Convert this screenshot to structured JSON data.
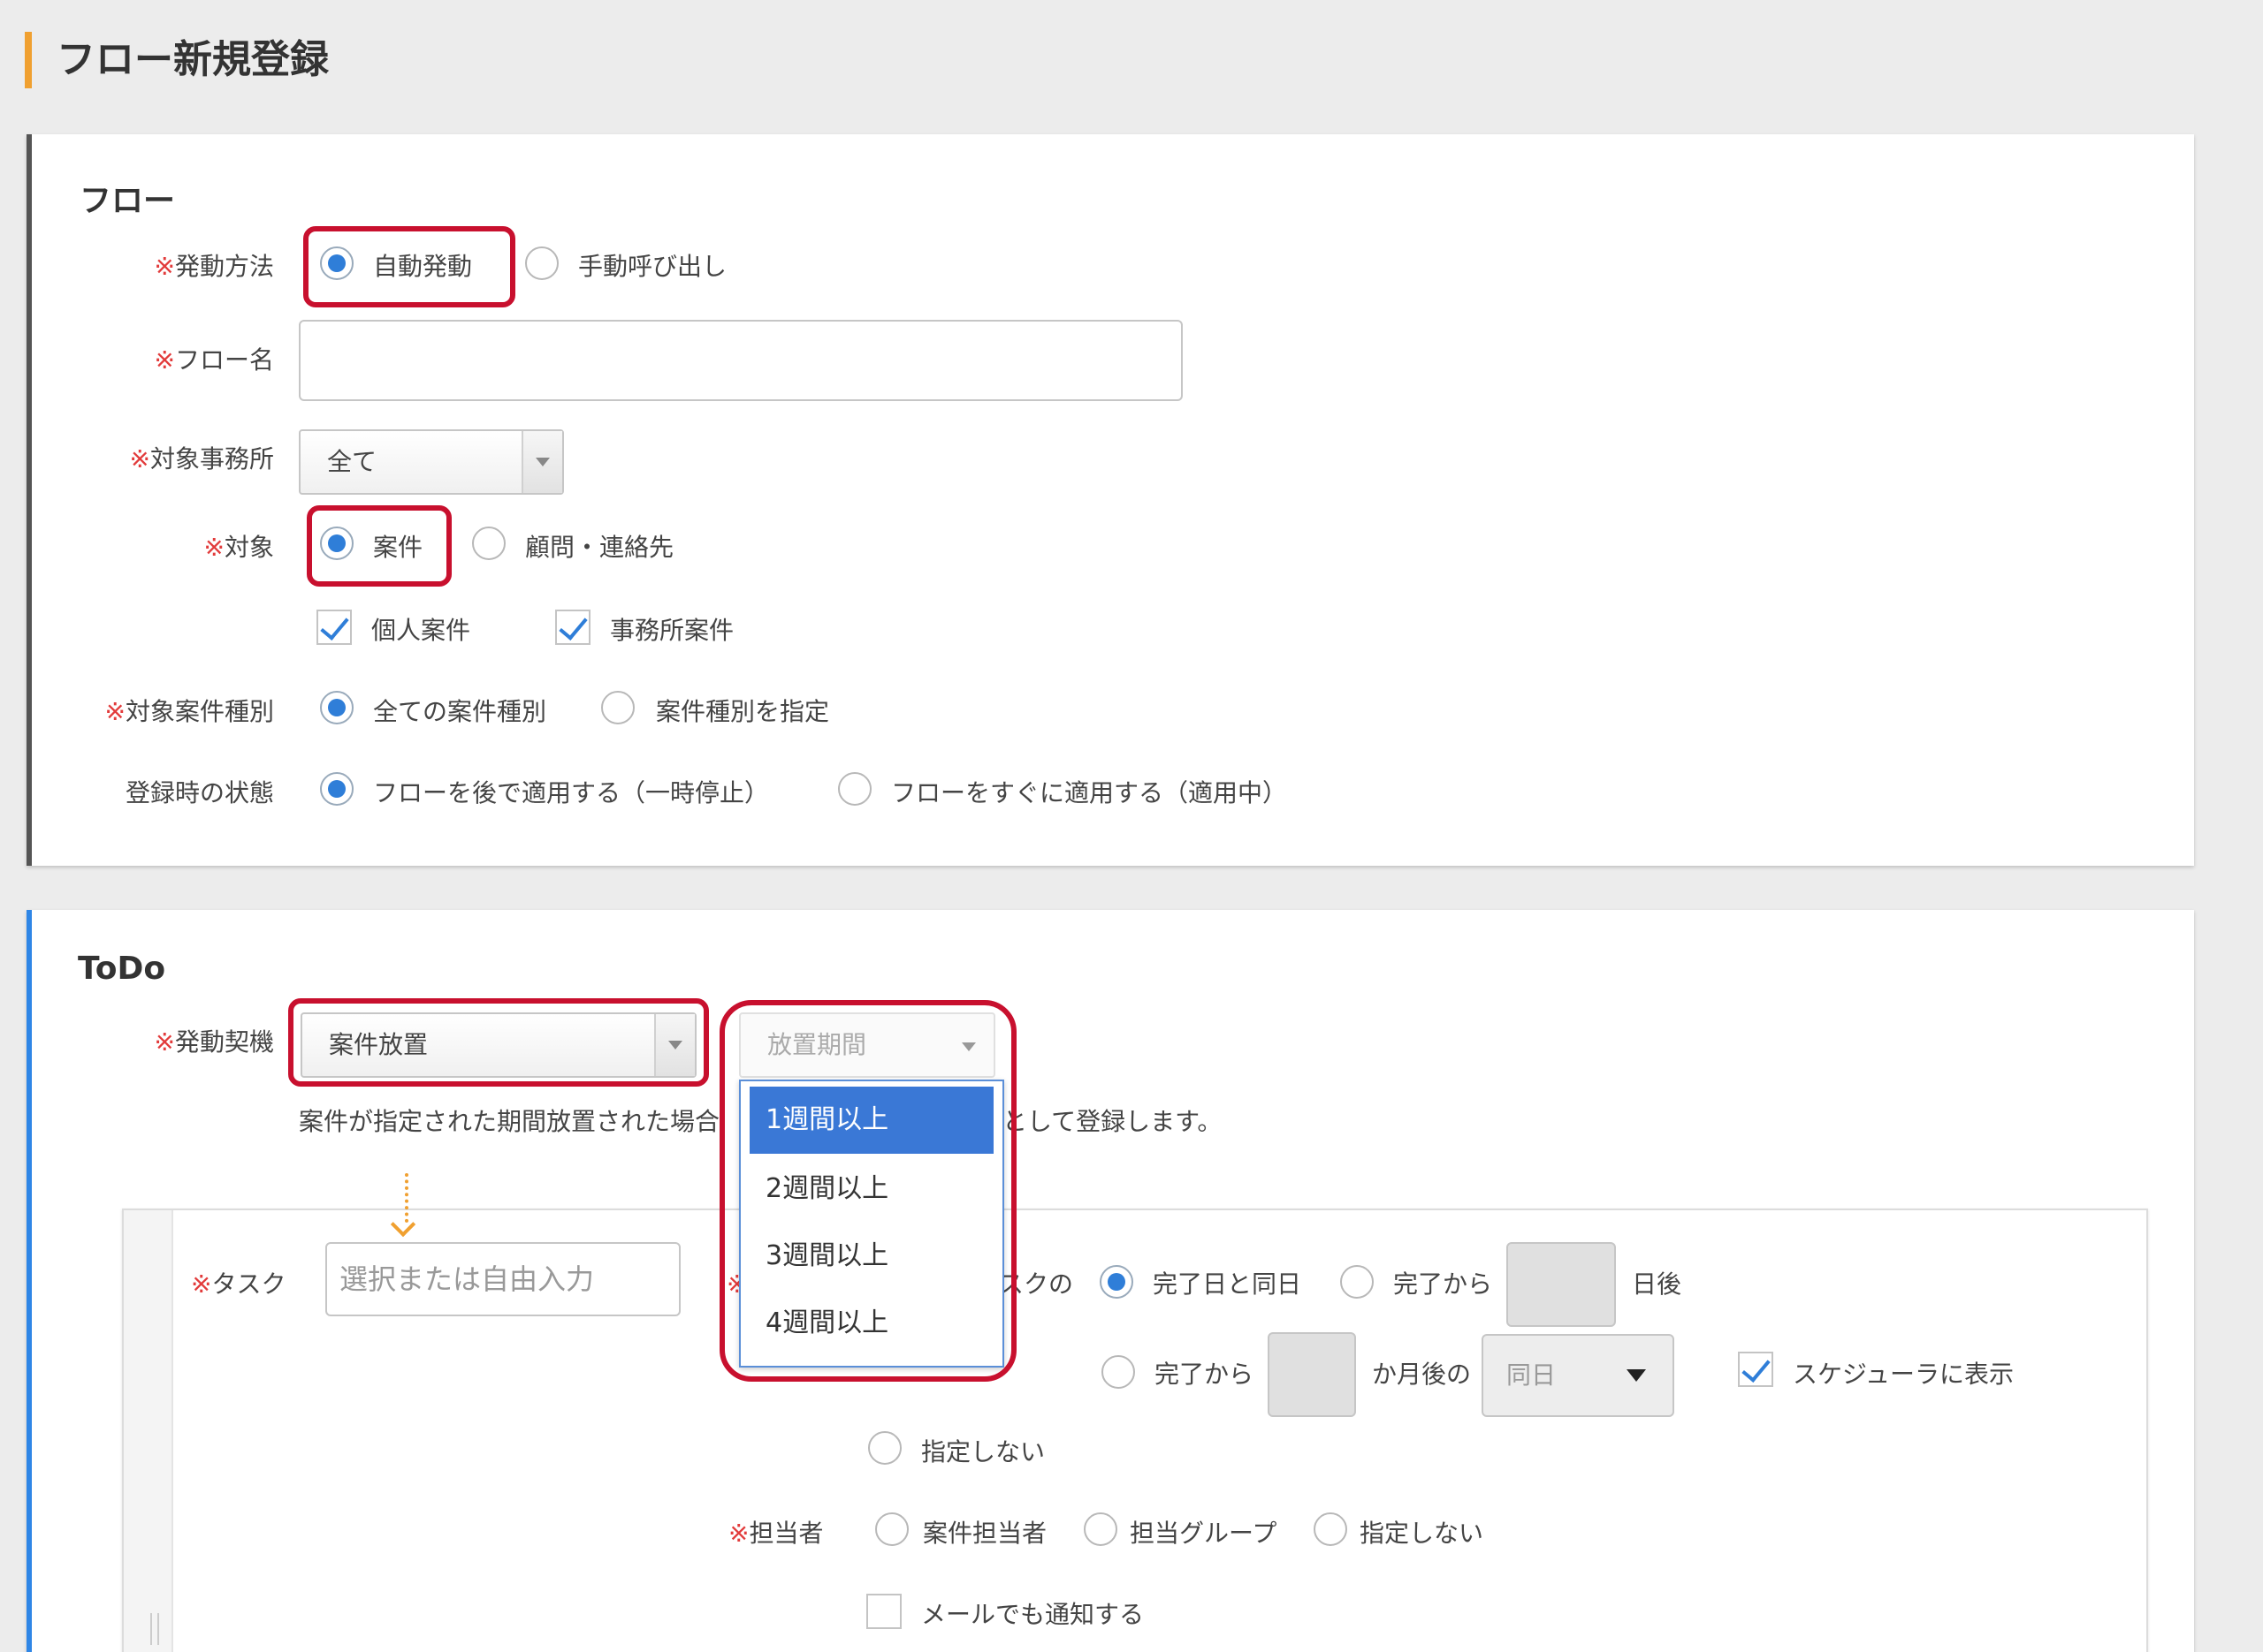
{
  "page": {
    "title": "フロー新規登録"
  },
  "flow": {
    "section_title": "フロー",
    "req_mark": "※",
    "trigger_method": {
      "label": "発動方法",
      "options": [
        "自動発動",
        "手動呼び出し"
      ],
      "selected": "自動発動"
    },
    "flow_name": {
      "label": "フロー名",
      "value": ""
    },
    "target_office": {
      "label": "対象事務所",
      "value": "全て"
    },
    "target": {
      "label": "対象",
      "options": [
        "案件",
        "顧問・連絡先"
      ],
      "selected": "案件"
    },
    "case_checks": [
      {
        "label": "個人案件",
        "checked": true
      },
      {
        "label": "事務所案件",
        "checked": true
      }
    ],
    "case_type": {
      "label": "対象案件種別",
      "options": [
        "全ての案件種別",
        "案件種別を指定"
      ],
      "selected": "全ての案件種別"
    },
    "initial_state": {
      "label": "登録時の状態",
      "options": [
        "フローを後で適用する（一時停止）",
        "フローをすぐに適用する（適用中）"
      ],
      "selected": "フローを後で適用する（一時停止）"
    }
  },
  "todo": {
    "section_title": "ToDo",
    "trigger": {
      "label": "発動契機",
      "value": "案件放置"
    },
    "period": {
      "placeholder": "放置期間",
      "options": [
        "1週間以上",
        "2週間以上",
        "3週間以上",
        "4週間以上"
      ],
      "highlighted": "1週間以上"
    },
    "help_text_left": "案件が指定された期間放置された場合",
    "help_text_right": "として登録します。",
    "task": {
      "label": "タスク",
      "placeholder": "選択または自由入力"
    },
    "due": {
      "prefix_partial": "スクの",
      "opt_same_day": "完了日と同日",
      "opt_days_after_prefix": "完了から",
      "opt_days_after_suffix": "日後",
      "opt_months_after_prefix": "完了から",
      "opt_months_after_suffix": "か月後の",
      "month_day_select": "同日",
      "opt_none": "指定しない",
      "selected": "完了日と同日"
    },
    "show_in_scheduler": {
      "label": "スケジューラに表示",
      "checked": true
    },
    "assignee": {
      "label": "担当者",
      "options": [
        "案件担当者",
        "担当グループ",
        "指定しない"
      ]
    },
    "email_notify": {
      "label": "メールでも通知する",
      "checked": false
    }
  },
  "colors": {
    "accent_orange": "#f0a030",
    "highlight_red": "#c8102e",
    "radio_blue": "#2f7ed8",
    "todo_border_blue": "#2f86e6"
  }
}
